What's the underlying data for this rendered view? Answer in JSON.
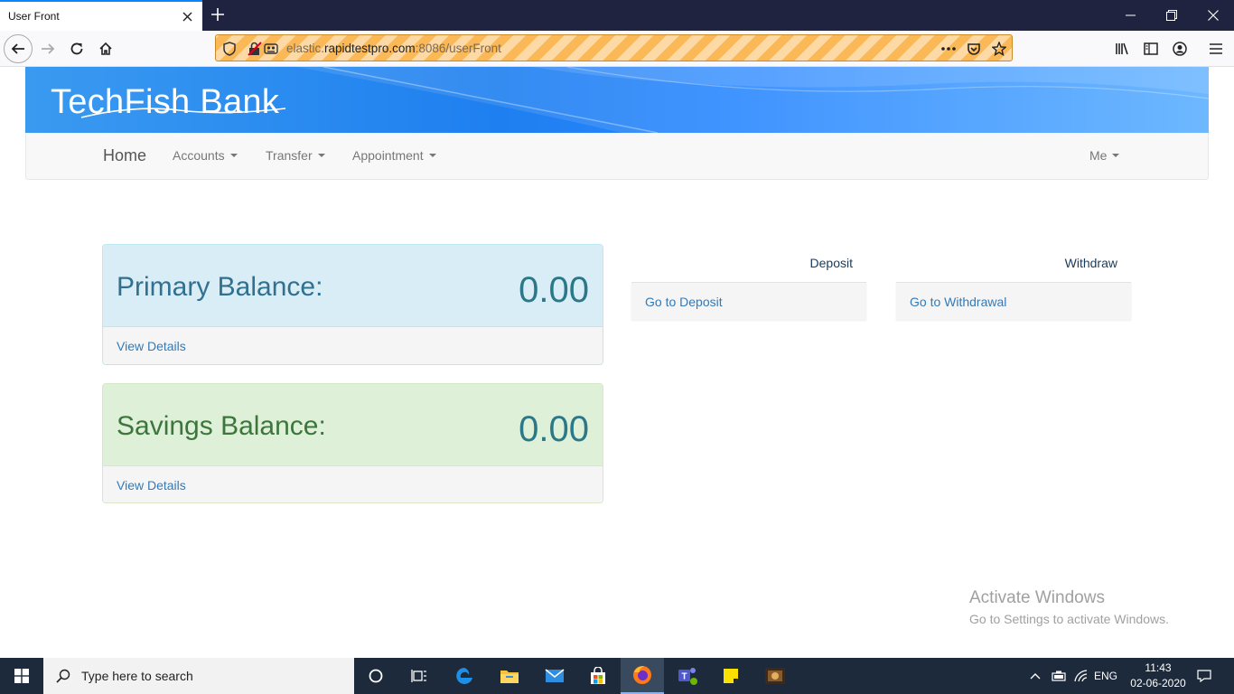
{
  "browser": {
    "tab_title": "User Front",
    "url_prefix": "elastic.",
    "url_domain": "rapidtestpro.com",
    "url_suffix": ":8086/userFront"
  },
  "app": {
    "logo_text": "TechFish Bank",
    "nav": {
      "home": "Home",
      "accounts": "Accounts",
      "transfer": "Transfer",
      "appointment": "Appointment",
      "me": "Me"
    }
  },
  "balances": {
    "primary": {
      "label": "Primary Balance:",
      "amount": "0.00",
      "link": "View Details"
    },
    "savings": {
      "label": "Savings Balance:",
      "amount": "0.00",
      "link": "View Details"
    }
  },
  "actions": {
    "deposit": {
      "title": "Deposit",
      "link": "Go to Deposit"
    },
    "withdraw": {
      "title": "Withdraw",
      "link": "Go to Withdrawal"
    }
  },
  "watermark": {
    "line1": "Activate Windows",
    "line2": "Go to Settings to activate Windows."
  },
  "taskbar": {
    "search_placeholder": "Type here to search",
    "language": "ENG",
    "time": "11:43",
    "date": "02-06-2020"
  }
}
